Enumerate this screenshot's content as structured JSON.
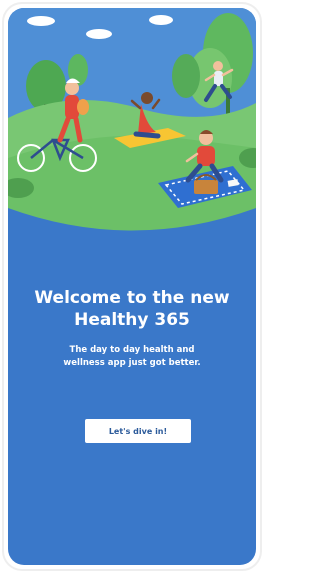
{
  "welcome": {
    "title_line1": "Welcome to the new",
    "title_line2": "Healthy 365",
    "subtitle_line1": "The day to day health and",
    "subtitle_line2": "wellness app just got better."
  },
  "cta": {
    "label": "Let's dive in!"
  },
  "colors": {
    "background_blue": "#3a78c9",
    "sky": "#4f8fd6",
    "grass": "#6cc067",
    "button_text": "#2b5a9a"
  },
  "illustration": {
    "icon": "park-activities-illustration"
  }
}
